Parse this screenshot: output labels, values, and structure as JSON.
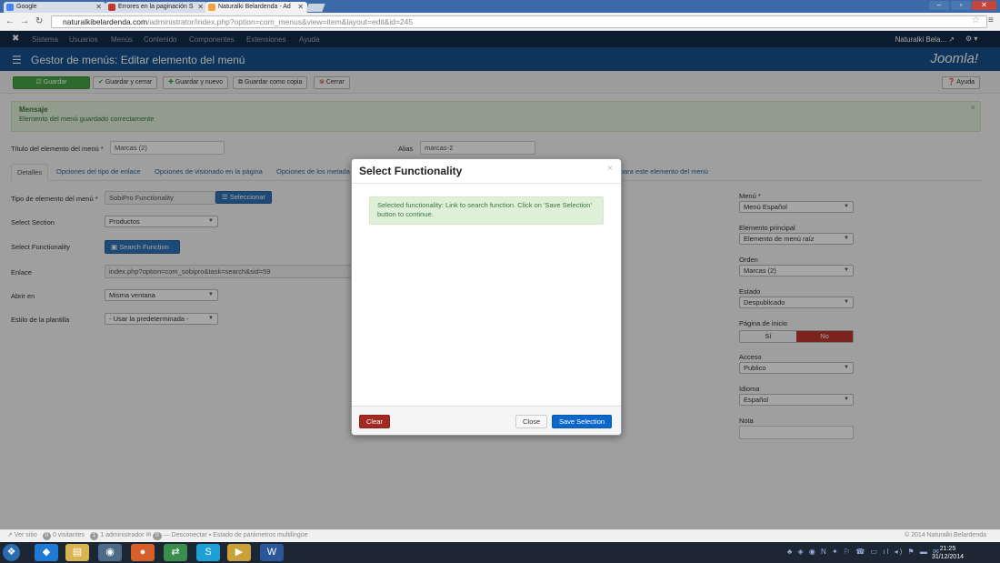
{
  "browser": {
    "tabs": [
      {
        "label": "Google"
      },
      {
        "label": "Errores en la paginación S"
      },
      {
        "label": "Naturalki Belardenda - Ad"
      }
    ],
    "url_domain": "naturalkibelardenda.com",
    "url_path": "/administrator/index.php?option=com_menus&view=item&layout=edit&id=245"
  },
  "joomla_nav": {
    "items": [
      "Sistema",
      "Usuarios",
      "Menús",
      "Contenido",
      "Componentes",
      "Extensiones",
      "Ayuda"
    ],
    "user": "Naturalki Bela... ↗"
  },
  "header": {
    "title": "Gestor de menús: Editar elemento del menú",
    "logo": "Joomla!"
  },
  "toolbar": {
    "save": "Guardar",
    "save_close": "Guardar y cerrar",
    "save_new": "Guardar y nuevo",
    "save_copy": "Guardar como copia",
    "close": "Cerrar",
    "help": "Ayuda"
  },
  "alert": {
    "heading": "Mensaje",
    "message": "Elemento del menú guardado correctamente"
  },
  "form": {
    "title_label": "Título del elemento del menú *",
    "title_value": "Marcas (2)",
    "alias_label": "Alias",
    "alias_value": "marcas-2",
    "tabs": [
      "Detalles",
      "Opciones del tipo de enlace",
      "Opciones de visionado en la página",
      "Opciones de los metada",
      "s para este elemento del menú"
    ],
    "type_label": "Tipo de elemento del menú *",
    "type_value": "SobiPro Functionality",
    "select_button": "Seleccionar",
    "section_label": "Select Section",
    "section_value": "Productos",
    "functionality_label": "Select Functionality",
    "functionality_button": "Search Function",
    "link_label": "Enlace",
    "link_value": "index.php?option=com_sobipro&task=search&sid=59",
    "open_label": "Abrir en",
    "open_value": "Misma ventana",
    "template_label": "Estilo de la plantilla",
    "template_value": "- Usar la predeterminada -"
  },
  "sidebar": {
    "menu_label": "Menú *",
    "menu_value": "Menú Español",
    "parent_label": "Elemento principal",
    "parent_value": "Elemento de menú raíz",
    "order_label": "Orden",
    "order_value": "Marcas (2)",
    "state_label": "Estado",
    "state_value": "Despublicado",
    "home_label": "Página de inicio",
    "home_yes": "Sí",
    "home_no": "No",
    "access_label": "Acceso",
    "access_value": "Publico",
    "language_label": "Idioma",
    "language_value": "Español",
    "note_label": "Nota"
  },
  "status_bar": {
    "view_site": "Ver sitio",
    "visitors_count": "0",
    "visitors": "0 visitantes",
    "admins_count": "1",
    "admins": "1 administrador",
    "msgs_count": "0",
    "logout": "— Desconectar",
    "multilingual": "Estado de parámetros multilingüe",
    "copyright": "© 2014 Naturalki Belardenda"
  },
  "modal": {
    "title": "Select Functionality",
    "info": "Selected functionality: Link to search function. Click on 'Save Selection' button to continue.",
    "clear": "Clear",
    "close": "Close",
    "save": "Save Selection"
  },
  "taskbar": {
    "time": "21:25",
    "date": "31/12/2014"
  },
  "colors": {
    "joomla_dark": "#122c4c",
    "joomla_header": "#17518e",
    "save_green": "#46a546",
    "primary_blue": "#0b67c9",
    "danger_red": "#a32a22"
  }
}
